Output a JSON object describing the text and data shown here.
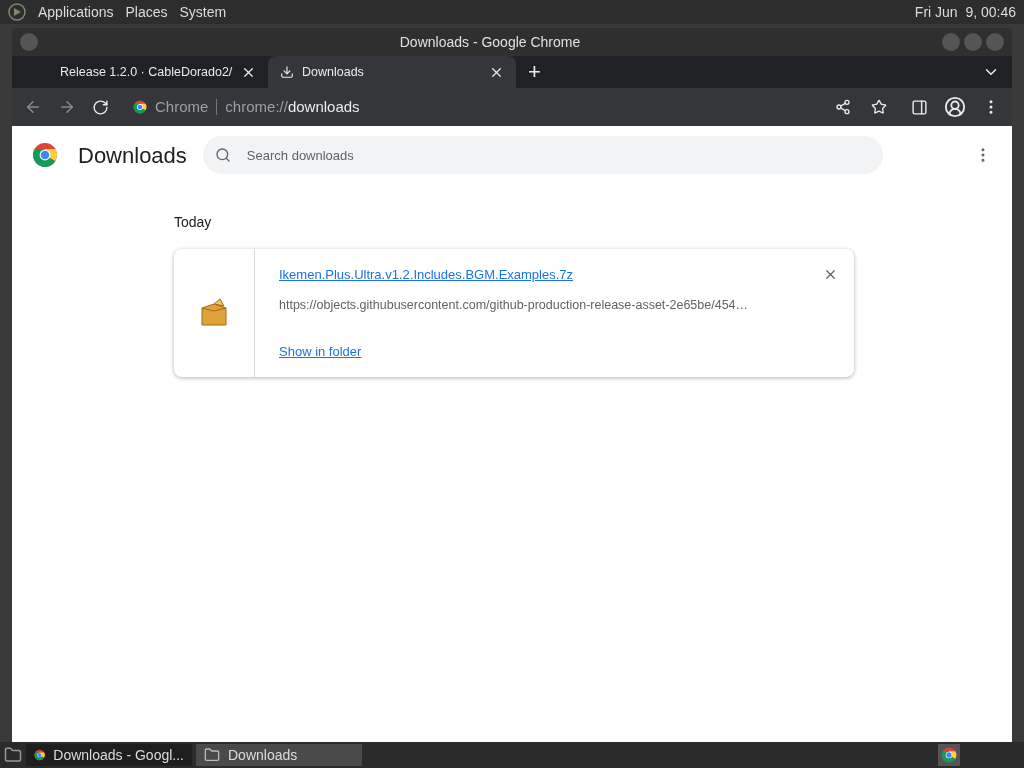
{
  "top_panel": {
    "menus": [
      "Applications",
      "Places",
      "System"
    ],
    "clock": "Fri Jun  9, 00:46"
  },
  "window": {
    "title": "Downloads - Google Chrome"
  },
  "tabs": [
    {
      "label": "Release 1.2.0 · CableDorado2/",
      "selected": false,
      "kind": "page"
    },
    {
      "label": "Downloads",
      "selected": true,
      "kind": "download"
    }
  ],
  "new_tab": "+",
  "address_bar": {
    "site": "Chrome",
    "scheme": "chrome://",
    "path": "downloads"
  },
  "page": {
    "title": "Downloads",
    "search": {
      "placeholder": "Search downloads"
    },
    "groups": [
      {
        "date": "Today",
        "items": [
          {
            "name": "Ikemen.Plus.Ultra.v1.2.Includes.BGM.Examples.7z",
            "url": "https://objects.githubusercontent.com/github-production-release-asset-2e65be/454…",
            "action": "Show in folder"
          }
        ]
      }
    ]
  },
  "taskbar": {
    "items": [
      {
        "label": "Downloads - Googl...",
        "kind": "chrome",
        "selected": true
      },
      {
        "label": "Downloads",
        "kind": "folder",
        "selected": false
      }
    ]
  }
}
